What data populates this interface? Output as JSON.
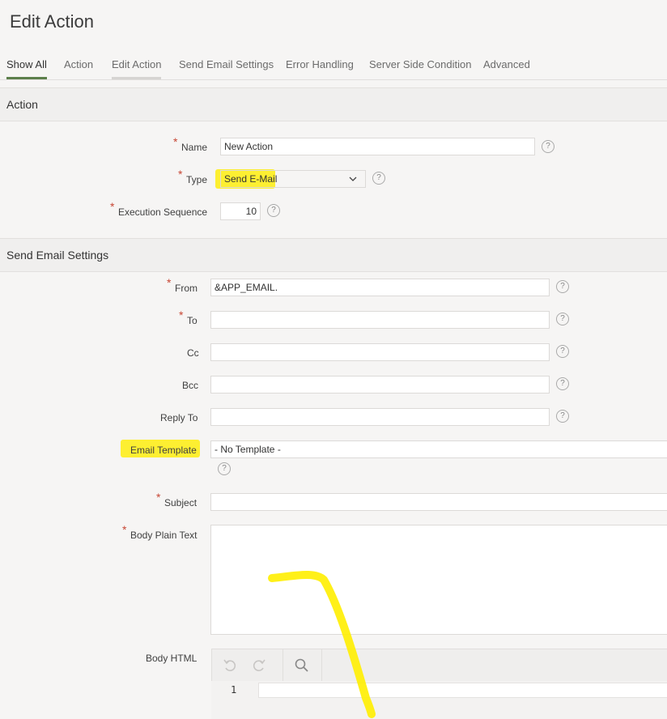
{
  "page": {
    "title": "Edit Action"
  },
  "tabs": [
    "Show All",
    "Action",
    "Edit Action",
    "Send Email Settings",
    "Error Handling",
    "Server Side Condition",
    "Advanced"
  ],
  "sections": {
    "action": "Action",
    "email": "Send Email Settings"
  },
  "action": {
    "name_label": "Name",
    "name_value": "New Action",
    "type_label": "Type",
    "type_value": "Send E-Mail",
    "seq_label": "Execution Sequence",
    "seq_value": "10"
  },
  "email": {
    "from_label": "From",
    "from_value": "&APP_EMAIL.",
    "to_label": "To",
    "to_value": "",
    "cc_label": "Cc",
    "cc_value": "",
    "bcc_label": "Bcc",
    "bcc_value": "",
    "reply_label": "Reply To",
    "reply_value": "",
    "template_label": "Email Template",
    "template_value": "- No Template -",
    "subject_label": "Subject",
    "subject_value": "",
    "body_plain_label": "Body Plain Text",
    "body_plain_value": "",
    "body_html_label": "Body HTML",
    "editor_line": "1"
  },
  "help_glyph": "?",
  "required_glyph": "*",
  "colors": {
    "highlight": "#ffee00",
    "active_tab": "#5c7f4b",
    "required": "#c74634"
  }
}
